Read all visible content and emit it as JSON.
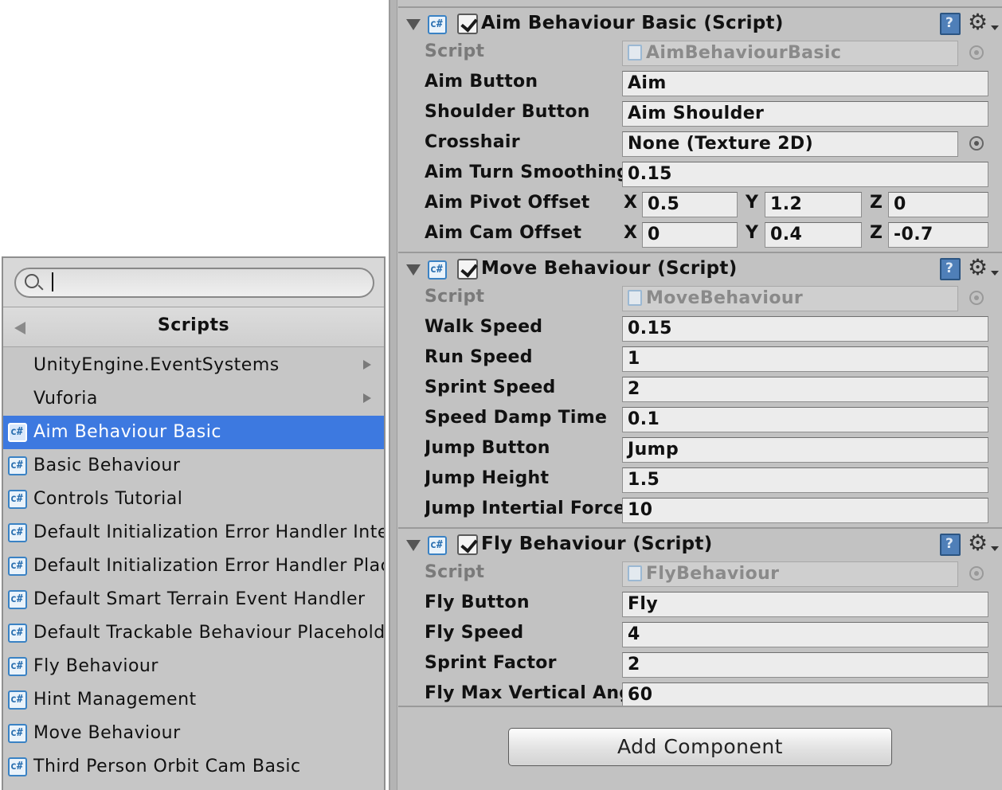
{
  "inspector": {
    "components": [
      {
        "title": "Aim Behaviour Basic (Script)",
        "enabled": true,
        "script_label": "Script",
        "script_value": "AimBehaviourBasic",
        "fields": [
          {
            "label": "Aim Button",
            "value": "Aim"
          },
          {
            "label": "Shoulder Button",
            "value": "Aim Shoulder"
          },
          {
            "label": "Crosshair",
            "value": "None (Texture 2D)"
          },
          {
            "label": "Aim Turn Smoothing",
            "value": "0.15"
          }
        ],
        "vectors": [
          {
            "label": "Aim Pivot Offset",
            "x": "0.5",
            "y": "1.2",
            "z": "0"
          },
          {
            "label": "Aim Cam Offset",
            "x": "0",
            "y": "0.4",
            "z": "-0.7"
          }
        ]
      },
      {
        "title": "Move Behaviour (Script)",
        "enabled": true,
        "script_label": "Script",
        "script_value": "MoveBehaviour",
        "fields": [
          {
            "label": "Walk Speed",
            "value": "0.15"
          },
          {
            "label": "Run Speed",
            "value": "1"
          },
          {
            "label": "Sprint Speed",
            "value": "2"
          },
          {
            "label": "Speed Damp Time",
            "value": "0.1"
          },
          {
            "label": "Jump Button",
            "value": "Jump"
          },
          {
            "label": "Jump Height",
            "value": "1.5"
          },
          {
            "label": "Jump Intertial Force",
            "value": "10"
          }
        ]
      },
      {
        "title": "Fly Behaviour (Script)",
        "enabled": true,
        "script_label": "Script",
        "script_value": "FlyBehaviour",
        "fields": [
          {
            "label": "Fly Button",
            "value": "Fly"
          },
          {
            "label": "Fly Speed",
            "value": "4"
          },
          {
            "label": "Sprint Factor",
            "value": "2"
          },
          {
            "label": "Fly Max Vertical Angle",
            "value": "60"
          }
        ]
      }
    ],
    "axis_labels": {
      "x": "X",
      "y": "Y",
      "z": "Z"
    },
    "add_component_label": "Add Component"
  },
  "picker": {
    "search_value": "",
    "title": "Scripts",
    "namespaces": [
      "UnityEngine.EventSystems",
      "Vuforia"
    ],
    "scripts": [
      "Aim Behaviour Basic",
      "Basic Behaviour",
      "Controls Tutorial",
      "Default Initialization Error Handler Internal",
      "Default Initialization Error Handler Placeholder",
      "Default Smart Terrain Event Handler",
      "Default Trackable Behaviour Placeholder",
      "Fly Behaviour",
      "Hint Management",
      "Move Behaviour",
      "Third Person Orbit Cam Basic"
    ],
    "selected_index": 0
  },
  "colors": {
    "selection": "#3d79e0",
    "inspector_bg": "#c2c2c2",
    "field_bg": "#ececec"
  }
}
